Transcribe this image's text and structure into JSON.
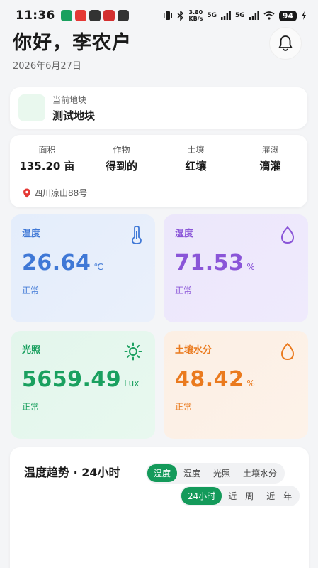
{
  "status_bar": {
    "time": "11:36",
    "net_speed_value": "3.80",
    "net_speed_unit": "KB/s",
    "signal_1": "5G",
    "signal_2": "5G",
    "battery": "94"
  },
  "header": {
    "greeting": "你好，李农户",
    "date": "2026年6月27日"
  },
  "plot": {
    "label": "当前地块",
    "name": "测试地块"
  },
  "info": {
    "items": [
      {
        "label": "面积",
        "value": "135.20 亩"
      },
      {
        "label": "作物",
        "value": "得到的"
      },
      {
        "label": "土壤",
        "value": "红壤"
      },
      {
        "label": "灌溉",
        "value": "滴灌"
      }
    ],
    "address": "四川凉山88号"
  },
  "metrics": {
    "temperature": {
      "label": "温度",
      "value": "26.64",
      "unit": "℃",
      "status": "正常",
      "icon": "thermometer-icon"
    },
    "humidity": {
      "label": "湿度",
      "value": "71.53",
      "unit": "%",
      "status": "正常",
      "icon": "droplet-icon"
    },
    "light": {
      "label": "光照",
      "value": "5659.49",
      "unit": "Lux",
      "status": "正常",
      "icon": "sun-icon"
    },
    "soil_moisture": {
      "label": "土壤水分",
      "value": "48.42",
      "unit": "%",
      "status": "正常",
      "icon": "droplet-icon"
    }
  },
  "trend": {
    "title": "温度趋势 · 24小时",
    "metric_tabs": [
      "温度",
      "湿度",
      "光照",
      "土壤水分"
    ],
    "range_tabs": [
      "24小时",
      "近一周",
      "近一年"
    ],
    "active_metric": "温度",
    "active_range": "24小时"
  },
  "colors": {
    "accent_green": "#149a5a",
    "temperature": "#3f78d6",
    "humidity": "#8a55d8",
    "light": "#1aa05f",
    "soil": "#ea7a1e"
  }
}
